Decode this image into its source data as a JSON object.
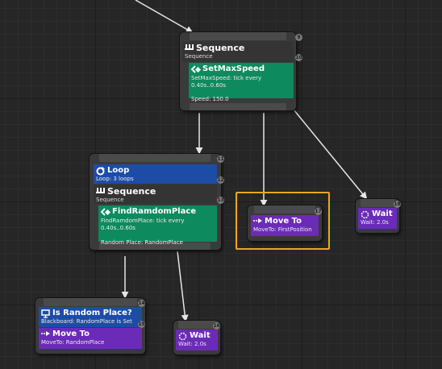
{
  "nodes": {
    "root_sequence": {
      "title": "Sequence",
      "subtitle": "Sequence",
      "order": "9"
    },
    "set_max_speed": {
      "title": "SetMaxSpeed",
      "description": "SetMaxSpeed: tick every 0.40s..0.60s",
      "property": "Speed: 150.0",
      "order": "10"
    },
    "loop": {
      "title": "Loop",
      "subtitle": "Loop: 3 loops",
      "order": "11"
    },
    "inner_sequence": {
      "title": "Sequence",
      "subtitle": "Sequence",
      "order": "13"
    },
    "find_random_place": {
      "title": "FindRamdomPlace",
      "description": "FindRamdomPlace: tick every 0.40s..0.60s",
      "property": "Random Place: RandomPlace",
      "order": "12"
    },
    "is_random_place": {
      "title": "Is Random Place?",
      "subtitle": "Blackboard: RandomPlace is Set",
      "order": "15"
    },
    "move_to_random": {
      "title": "Move To",
      "subtitle": "MoveTo: RandomPlace",
      "order": "14"
    },
    "wait_bottom": {
      "title": "Wait",
      "subtitle": "Wait: 2.0s",
      "order": "16"
    },
    "move_to_first": {
      "title": "Move To",
      "subtitle": "MoveTo: FirstPosition",
      "order": "17"
    },
    "wait_right": {
      "title": "Wait",
      "subtitle": "Wait: 2.0s",
      "order": "18"
    }
  },
  "colors": {
    "service": "#0e8a5f",
    "task": "#6b2bb8",
    "decorator": "#1d4ca6",
    "selection": "#e8a81e",
    "wire": "#e6e6e6"
  },
  "icons": {
    "sequence": "sequence-icon",
    "service": "service-icon",
    "loop": "loop-icon",
    "blackboard": "blackboard-icon",
    "move_to": "move-to-icon",
    "wait": "wait-icon"
  }
}
